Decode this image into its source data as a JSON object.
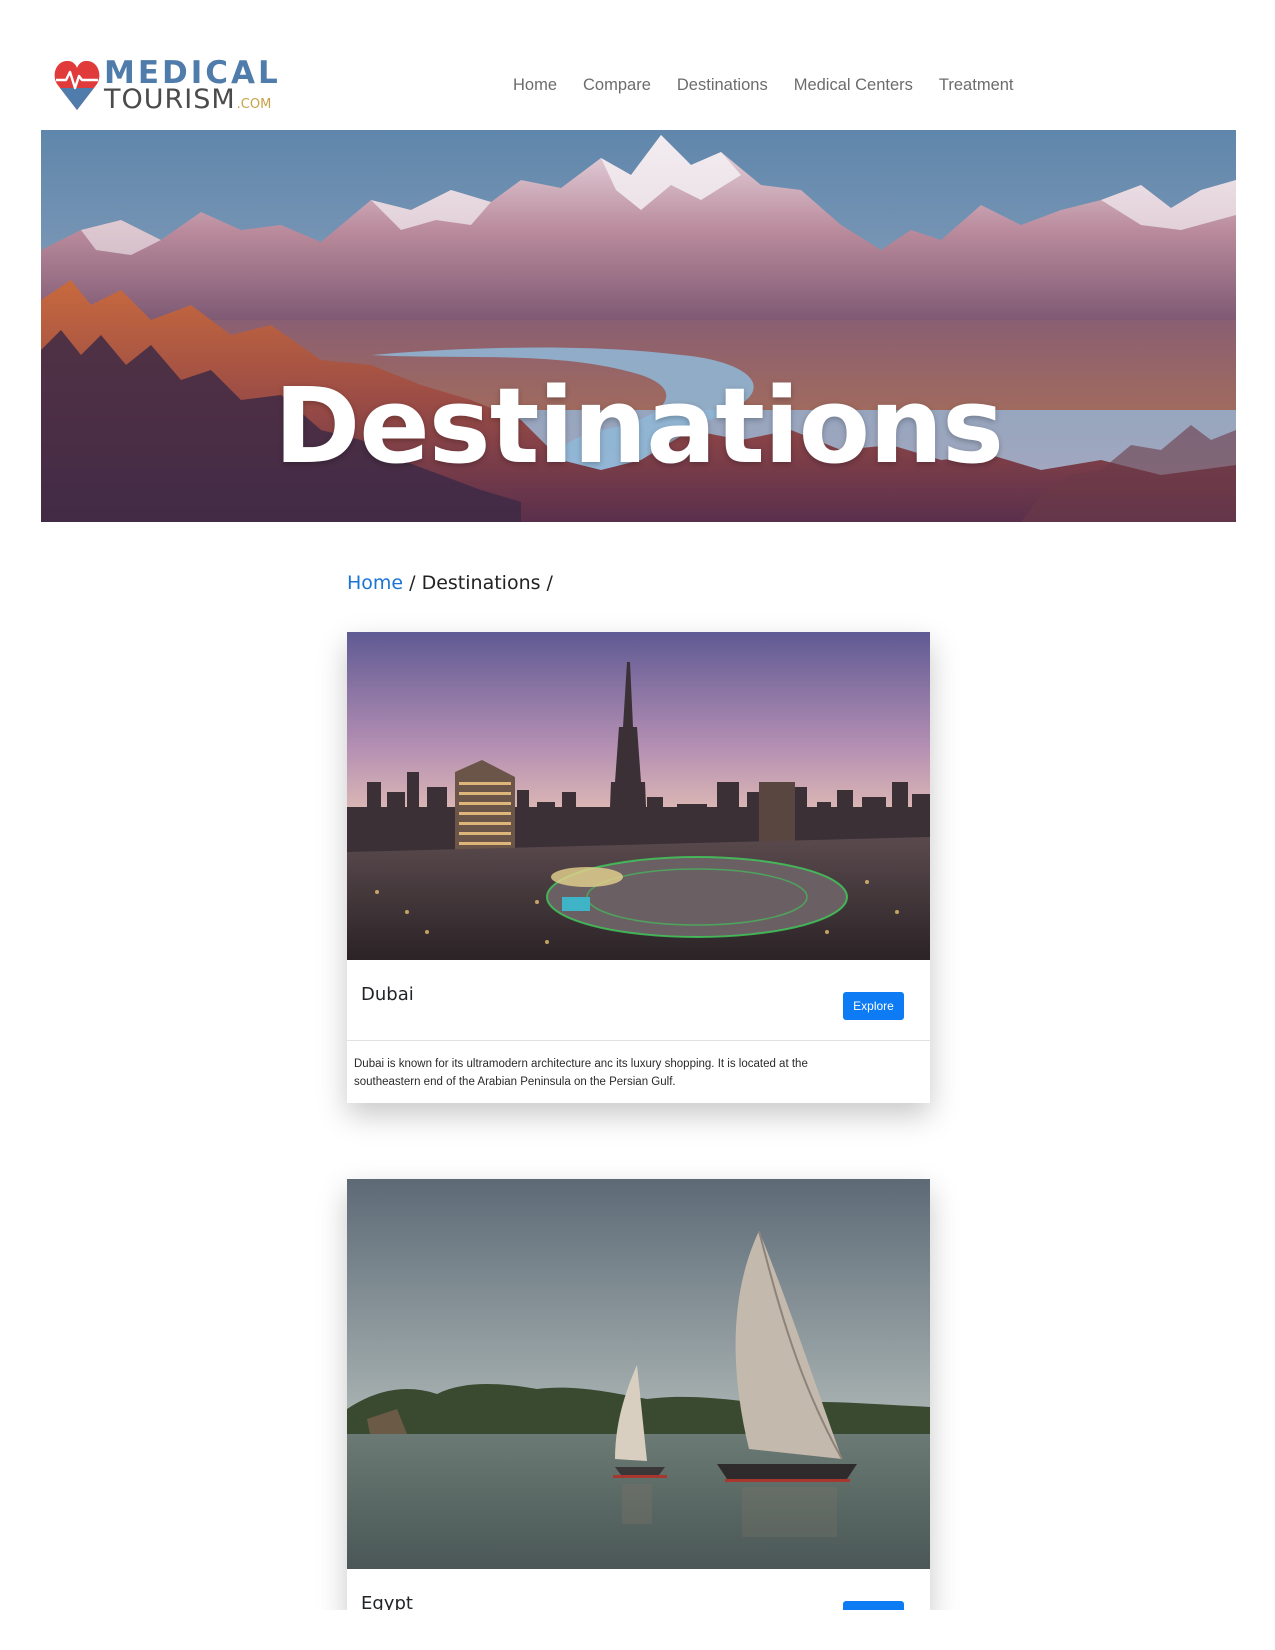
{
  "header": {
    "logo": {
      "top_text": "MEDICAL",
      "bottom_text": "TOURISM",
      "suffix": ".COM"
    },
    "nav": [
      {
        "label": "Home"
      },
      {
        "label": "Compare"
      },
      {
        "label": "Destinations"
      },
      {
        "label": "Medical Centers"
      },
      {
        "label": "Treatment"
      }
    ]
  },
  "hero": {
    "title": "Destinations"
  },
  "breadcrumb": {
    "home_label": "Home",
    "trail": " / Destinations /"
  },
  "cards": [
    {
      "title": "Dubai",
      "button_label": "Explore",
      "description": "Dubai is known for its ultramodern architecture anc its luxury shopping. It is located at the southeastern end of the Arabian Peninsula on the Persian Gulf."
    },
    {
      "title": "Egypt",
      "button_label": ""
    }
  ],
  "colors": {
    "link": "#1b74d4",
    "button": "#0d7bf3",
    "logo_blue": "#4f7cab",
    "logo_red": "#e03a3a"
  }
}
